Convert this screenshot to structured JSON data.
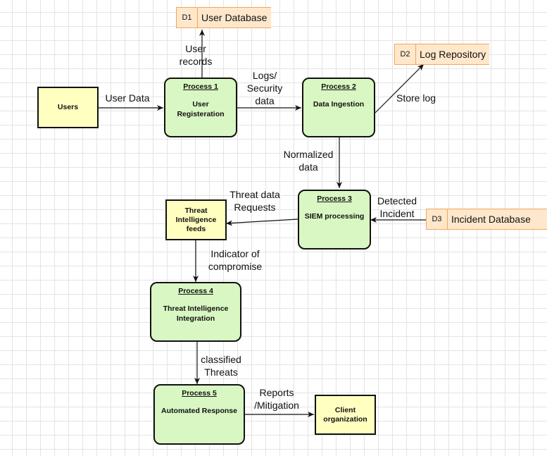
{
  "entities": {
    "users": "Users",
    "threat_feeds": "Threat Intelligence feeds",
    "client": "Client organization"
  },
  "processes": {
    "p1": {
      "title": "Process 1",
      "name": "User Registeration"
    },
    "p2": {
      "title": "Process 2",
      "name": "Data Ingestion"
    },
    "p3": {
      "title": "Process 3",
      "name": "SIEM processing"
    },
    "p4": {
      "title": "Process 4",
      "name": "Threat Intelligence Integration"
    },
    "p5": {
      "title": "Process 5",
      "name": "Automated Response"
    }
  },
  "stores": {
    "d1": {
      "id": "D1",
      "name": "User Database"
    },
    "d2": {
      "id": "D2",
      "name": "Log Repository"
    },
    "d3": {
      "id": "D3",
      "name": "Incident Database"
    }
  },
  "flows": {
    "user_data": "User Data",
    "user_records": "User\nrecords",
    "logs_security": "Logs/\nSecurity\ndata",
    "store_log": "Store log",
    "normalized": "Normalized\ndata",
    "detected_incident": "Detected\nIncident",
    "threat_requests": "Threat data\nRequests",
    "ioc": "Indicator of\ncompromise",
    "classified": "classified\nThreats",
    "reports": "Reports\n/Mitigation"
  }
}
